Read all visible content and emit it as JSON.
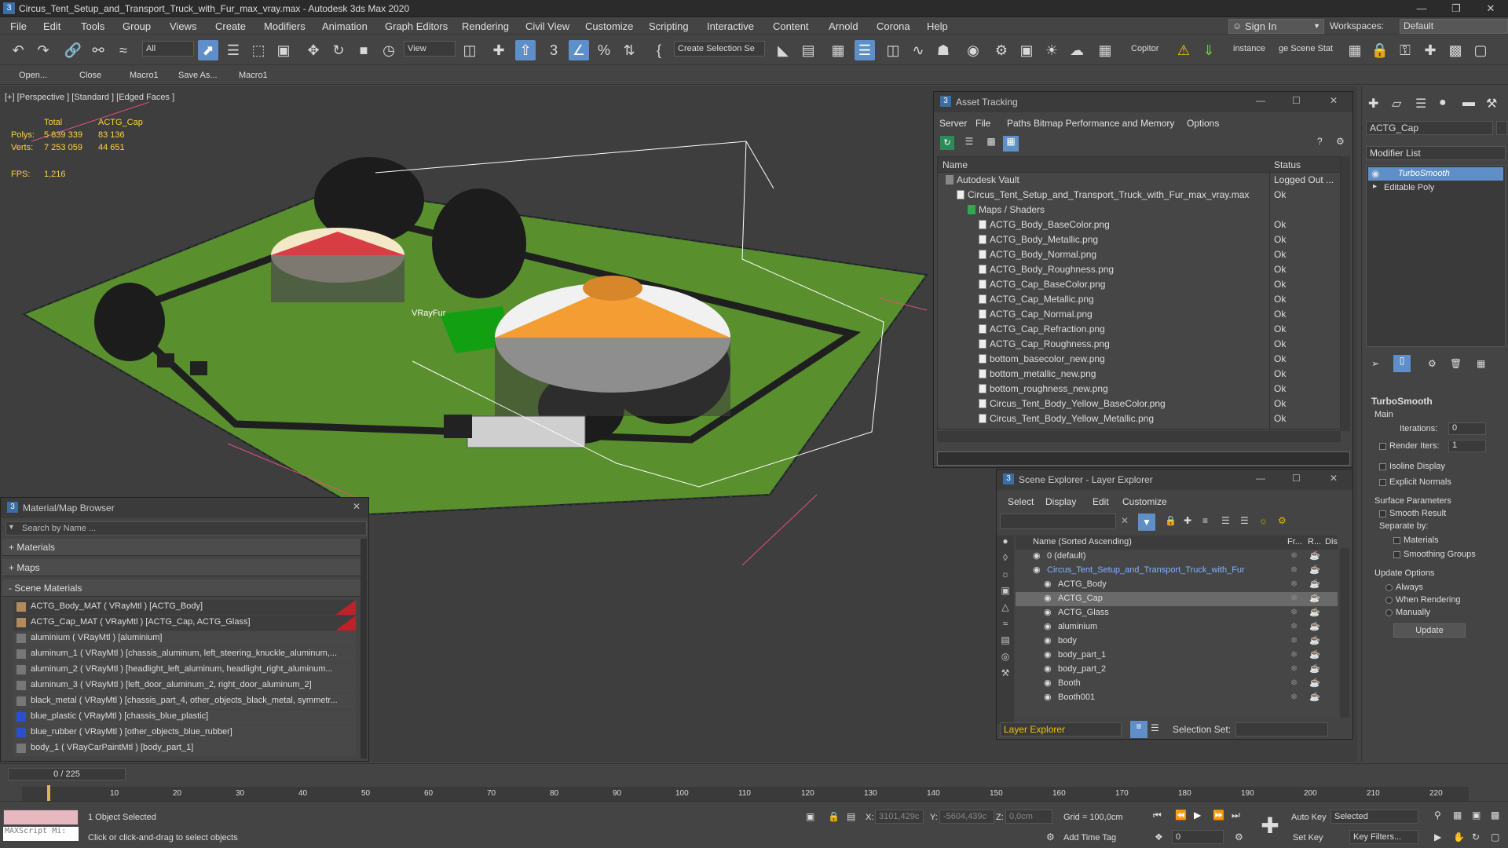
{
  "window": {
    "title": "Circus_Tent_Setup_and_Transport_Truck_with_Fur_max_vray.max - Autodesk 3ds Max 2020",
    "app_icon": "3"
  },
  "menu": [
    "File",
    "Edit",
    "Tools",
    "Group",
    "Views",
    "Create",
    "Modifiers",
    "Animation",
    "Graph Editors",
    "Rendering",
    "Civil View",
    "Customize",
    "Scripting",
    "Interactive",
    "Content",
    "Arnold",
    "Corona",
    "Help"
  ],
  "signin": "Sign In",
  "workspaces": {
    "label": "Workspaces:",
    "value": "Default"
  },
  "toolbar": {
    "filter": "All",
    "refcoord": "View",
    "selection_set": "Create Selection Se",
    "copitor": "Copitor",
    "instance": "instance",
    "scene_stat": "ge Scene Stat"
  },
  "shelf": [
    "Open...",
    "Close",
    "Macro1",
    "Save As...",
    "Macro1"
  ],
  "viewport": {
    "label": "[+] [Perspective ] [Standard ] [Edged Faces ]",
    "stats": {
      "col_total": "Total",
      "col_obj": "ACTG_Cap",
      "polys_label": "Polys:",
      "polys_total": "5 839 339",
      "polys_obj": "83 136",
      "verts_label": "Verts:",
      "verts_total": "7 253 059",
      "verts_obj": "44 651",
      "fps_label": "FPS:",
      "fps": "1,216"
    },
    "tag": "VRayFur"
  },
  "asset_tracking": {
    "title": "Asset Tracking",
    "menu": [
      "Server",
      "File",
      "Paths",
      "Bitmap Performance and Memory",
      "Options"
    ],
    "col_name": "Name",
    "col_status": "Status",
    "rows": [
      {
        "name": "Autodesk Vault",
        "status": "Logged Out ..."
      },
      {
        "name": "Circus_Tent_Setup_and_Transport_Truck_with_Fur_max_vray.max",
        "status": "Ok"
      },
      {
        "name": "Maps / Shaders",
        "status": ""
      },
      {
        "name": "ACTG_Body_BaseColor.png",
        "status": "Ok"
      },
      {
        "name": "ACTG_Body_Metallic.png",
        "status": "Ok"
      },
      {
        "name": "ACTG_Body_Normal.png",
        "status": "Ok"
      },
      {
        "name": "ACTG_Body_Roughness.png",
        "status": "Ok"
      },
      {
        "name": "ACTG_Cap_BaseColor.png",
        "status": "Ok"
      },
      {
        "name": "ACTG_Cap_Metallic.png",
        "status": "Ok"
      },
      {
        "name": "ACTG_Cap_Normal.png",
        "status": "Ok"
      },
      {
        "name": "ACTG_Cap_Refraction.png",
        "status": "Ok"
      },
      {
        "name": "ACTG_Cap_Roughness.png",
        "status": "Ok"
      },
      {
        "name": "bottom_basecolor_new.png",
        "status": "Ok"
      },
      {
        "name": "bottom_metallic_new.png",
        "status": "Ok"
      },
      {
        "name": "bottom_roughness_new.png",
        "status": "Ok"
      },
      {
        "name": "Circus_Tent_Body_Yellow_BaseColor.png",
        "status": "Ok"
      },
      {
        "name": "Circus_Tent_Body_Yellow_Metallic.png",
        "status": "Ok"
      }
    ]
  },
  "material_browser": {
    "title": "Material/Map Browser",
    "search_placeholder": "Search by Name ...",
    "groups": [
      "+ Materials",
      "+ Maps",
      "- Scene Materials"
    ],
    "items": [
      "ACTG_Body_MAT ( VRayMtl ) [ACTG_Body]",
      "ACTG_Cap_MAT ( VRayMtl ) [ACTG_Cap, ACTG_Glass]",
      "aluminium ( VRayMtl ) [aluminium]",
      "aluminum_1 ( VRayMtl ) [chassis_aluminum, left_steering_knuckle_aluminum,...",
      "aluminum_2 ( VRayMtl ) [headlight_left_aluminum, headlight_right_aluminum...",
      "aluminum_3 ( VRayMtl ) [left_door_aluminum_2, right_door_aluminum_2]",
      "black_metal ( VRayMtl ) [chassis_part_4, other_objects_black_metal, symmetr...",
      "blue_plastic ( VRayMtl ) [chassis_blue_plastic]",
      "blue_rubber ( VRayMtl ) [other_objects_blue_rubber]",
      "body_1 ( VRayCarPaintMtl ) [body_part_1]"
    ]
  },
  "scene_explorer": {
    "title": "Scene Explorer - Layer Explorer",
    "menu": [
      "Select",
      "Display",
      "Edit",
      "Customize"
    ],
    "col_name": "Name (Sorted Ascending)",
    "col_fr": "Fr...",
    "col_r": "R...",
    "col_disp": "Displ",
    "rows": [
      "0 (default)",
      "Circus_Tent_Setup_and_Transport_Truck_with_Fur",
      "ACTG_Body",
      "ACTG_Cap",
      "ACTG_Glass",
      "aluminium",
      "body",
      "body_part_1",
      "body_part_2",
      "Booth",
      "Booth001"
    ],
    "explorer_select": "Layer Explorer",
    "selection_set_label": "Selection Set:"
  },
  "command_panel": {
    "object_name": "ACTG_Cap",
    "modifier_list": "Modifier List",
    "stack": [
      "TurboSmooth",
      "Editable Poly"
    ],
    "rollout_title": "TurboSmooth",
    "main": "Main",
    "iterations_label": "Iterations:",
    "iterations": "0",
    "render_iters_label": "Render Iters:",
    "render_iters": "1",
    "isoline": "Isoline Display",
    "explicit_normals": "Explicit Normals",
    "surface_params": "Surface Parameters",
    "smooth_result": "Smooth Result",
    "separate_by": "Separate by:",
    "materials": "Materials",
    "smoothing_groups": "Smoothing Groups",
    "update_options": "Update Options",
    "always": "Always",
    "when_rendering": "When Rendering",
    "manually": "Manually",
    "update_button": "Update"
  },
  "timeline": {
    "frame": "0 / 225",
    "ticks": [
      "10",
      "20",
      "30",
      "40",
      "50",
      "60",
      "70",
      "80",
      "90",
      "100",
      "110",
      "120",
      "130",
      "140",
      "150",
      "160",
      "170",
      "180",
      "190",
      "200",
      "210",
      "220"
    ]
  },
  "status": {
    "maxscript": "MAXScript Mi:",
    "selected": "1 Object Selected",
    "prompt": "Click or click-and-drag to select objects",
    "x_label": "X:",
    "x": "3101,429c",
    "y_label": "Y:",
    "y": "-5604,439c",
    "z_label": "Z:",
    "z": "0,0cm",
    "grid": "Grid = 100,0cm",
    "add_time_tag": "Add Time Tag",
    "auto_key": "Auto Key",
    "set_key": "Set Key",
    "key_mode": "Selected",
    "key_filters": "Key Filters...",
    "frame_field": "0"
  }
}
